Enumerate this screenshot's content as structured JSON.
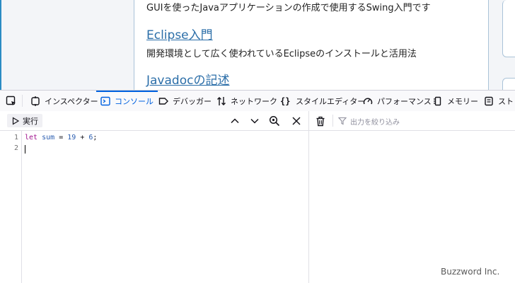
{
  "page": {
    "line1": "GUIを使ったJavaアプリケーションの作成で使用するSwing入門です",
    "link1": "Eclipse入門",
    "desc1": "開発環境として広く使われているEclipseのインストールと活用法",
    "link2": "Javadocの記述"
  },
  "devtools": {
    "tabs": [
      {
        "label": "インスペクター",
        "icon": "inspector-icon"
      },
      {
        "label": "コンソール",
        "icon": "console-icon",
        "selected": true
      },
      {
        "label": "デバッガー",
        "icon": "debugger-icon"
      },
      {
        "label": "ネットワーク",
        "icon": "network-icon"
      },
      {
        "label": "スタイルエディター",
        "icon": "style-editor-icon"
      },
      {
        "label": "パフォーマンス",
        "icon": "performance-icon"
      },
      {
        "label": "メモリー",
        "icon": "memory-icon"
      },
      {
        "label": "ストレ",
        "icon": "storage-icon"
      }
    ],
    "run_label": "実行",
    "filter_placeholder": "出力を絞り込み",
    "accent": "#0061e0"
  },
  "editor": {
    "line_numbers": [
      "1",
      "2"
    ],
    "code": {
      "keyword": "let",
      "var": "sum",
      "op": "=",
      "n1": "19",
      "plus": "+",
      "n2": "6",
      "end": ";"
    }
  },
  "watermark": "Buzzword Inc."
}
